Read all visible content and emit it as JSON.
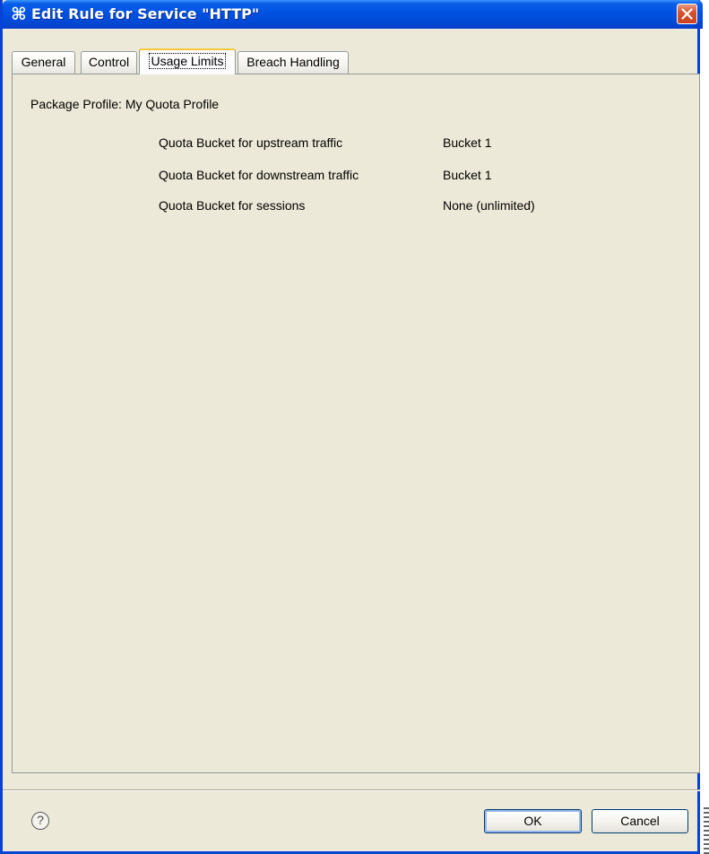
{
  "window": {
    "title": "Edit Rule for Service \"HTTP\"",
    "icon": "cisco-scas-icon",
    "close_icon": "close-icon"
  },
  "tabs": [
    {
      "label": "General",
      "active": false
    },
    {
      "label": "Control",
      "active": false
    },
    {
      "label": "Usage Limits",
      "active": true
    },
    {
      "label": "Breach Handling",
      "active": false
    }
  ],
  "usage_limits": {
    "package_profile": "Package Profile: My Quota Profile",
    "rows": [
      {
        "label": "Quota Bucket for upstream traffic",
        "value": "Bucket 1"
      },
      {
        "label": "Quota Bucket for downstream traffic",
        "value": "Bucket 1"
      },
      {
        "label": "Quota Bucket for sessions",
        "value": "None (unlimited)"
      }
    ]
  },
  "footer": {
    "help_glyph": "?",
    "ok_label": "OK",
    "cancel_label": "Cancel"
  },
  "colors": {
    "titlebar": "#0054e3",
    "dialog_background": "#ece9d8",
    "active_tab_highlight": "#ffc83c",
    "close_button": "#d8542f"
  }
}
